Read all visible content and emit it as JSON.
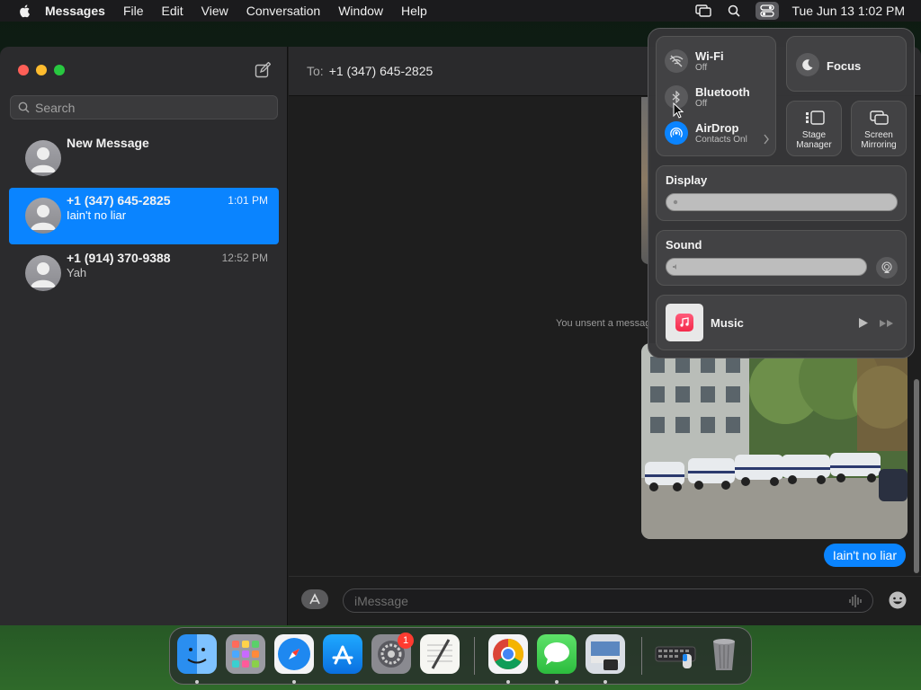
{
  "menubar": {
    "app_name": "Messages",
    "menus": [
      "File",
      "Edit",
      "View",
      "Conversation",
      "Window",
      "Help"
    ],
    "clock": "Tue Jun 13  1:02 PM"
  },
  "sidebar": {
    "search_placeholder": "Search",
    "conversations": [
      {
        "name": "New Message",
        "preview": "",
        "time": ""
      },
      {
        "name": "+1 (347) 645-2825",
        "preview": "Iain't no liar",
        "time": "1:01 PM",
        "selected": true
      },
      {
        "name": "+1 (914) 370-9388",
        "preview": "Yah",
        "time": "12:52 PM"
      }
    ]
  },
  "conversation": {
    "to_label": "To:",
    "recipient": "+1 (347) 645-2825",
    "unsent_notice": "You unsent a messag",
    "last_message": "Iain't no liar",
    "input_placeholder": "iMessage"
  },
  "control_center": {
    "wifi": {
      "label": "Wi-Fi",
      "status": "Off"
    },
    "bluetooth": {
      "label": "Bluetooth",
      "status": "Off"
    },
    "airdrop": {
      "label": "AirDrop",
      "status": "Contacts Onl"
    },
    "focus": {
      "label": "Focus"
    },
    "stage_manager": {
      "line1": "Stage",
      "line2": "Manager"
    },
    "screen_mirroring": {
      "line1": "Screen",
      "line2": "Mirroring"
    },
    "display": {
      "label": "Display",
      "level": 0.0
    },
    "sound": {
      "label": "Sound",
      "level": 0.0
    },
    "music": {
      "label": "Music"
    }
  },
  "dock": {
    "items": [
      "finder-icon",
      "launchpad-icon",
      "safari-icon",
      "app-store-icon",
      "system-settings-icon",
      "textedit-icon",
      "chrome-icon",
      "messages-icon",
      "preview-icon",
      "keyboard-viewer-icon",
      "trash-icon"
    ],
    "settings_badge": "1"
  },
  "colors": {
    "accent": "#0a84ff",
    "menubar": "#1b1b1d",
    "sidebar": "#2b2b2d"
  }
}
